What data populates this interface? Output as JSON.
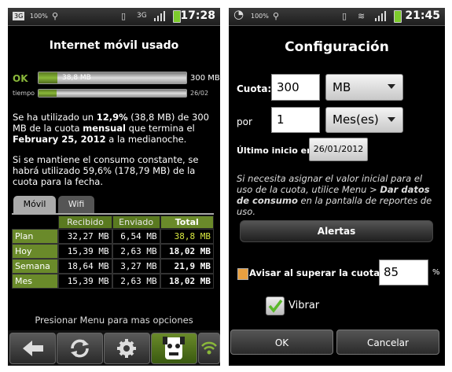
{
  "left": {
    "status_bar": {
      "time": "17:28",
      "network": "3G",
      "left_icons": [
        "3G",
        "100%"
      ]
    },
    "title": "Internet móvil usado",
    "usage_bar": {
      "status": "OK",
      "used_label": "38,8 MB",
      "total_label": "300 MB",
      "used_fraction": 0.129
    },
    "time_bar": {
      "label": "tiempo",
      "end_label": "26/02",
      "elapsed_fraction": 0.12
    },
    "summary": {
      "p1": "Se ha utilizado un ",
      "pct": "12,9%",
      "p2": " (38,8 MB) de 300 MB de la cuota ",
      "period": "mensual",
      "p3": " que termina el ",
      "date": "February 25, 2012",
      "p4": " a la medianoche."
    },
    "projection": "Si se mantiene el consumo constante, se habrá utilizado 59,6% (178,79 MB) de la cuota para la fecha.",
    "tabs": [
      "Móvil",
      "Wifi"
    ],
    "table": {
      "headers": [
        "Recibido",
        "Enviado",
        "Total"
      ],
      "rows": [
        {
          "label": "Plan",
          "recibido": "32,27 MB",
          "enviado": "6,54 MB",
          "total": "38,8 MB"
        },
        {
          "label": "Hoy",
          "recibido": "15,39 MB",
          "enviado": "2,63 MB",
          "total": "18,02 MB"
        },
        {
          "label": "Semana",
          "recibido": "18,64 MB",
          "enviado": "3,27 MB",
          "total": "21,9 MB"
        },
        {
          "label": "Mes",
          "recibido": "15,39 MB",
          "enviado": "2,63 MB",
          "total": "18,02 MB"
        }
      ]
    },
    "hint": "Presionar Menu para mas opciones",
    "bottom_buttons": [
      "back-arrow-icon",
      "refresh-icon",
      "settings-gear-icon",
      "app-mascot-icon",
      "wifi-icon"
    ],
    "colors": {
      "accent_green": "#8ab83a",
      "highlight_yellow": "#d8e840"
    }
  },
  "right": {
    "status_bar": {
      "time": "21:45",
      "left_icons": [
        "app-icon",
        "100%"
      ]
    },
    "title": "Configuración",
    "cuota_label": "Cuota:",
    "cuota_value": "300",
    "cuota_unit": "MB",
    "por_label": "por",
    "por_value": "1",
    "por_unit": "Mes(es)",
    "last_start_label": "Último inicio en",
    "last_start_value": "26/01/2012",
    "info": {
      "p1": "Si necesita asignar el valor inicial para el uso de la cuota, utilice Menu > ",
      "bold": "Dar datos de consumo",
      "p2": " en la pantalla de reportes de uso."
    },
    "alerts_button": "Alertas",
    "alert_threshold_label": "Avisar al superar la cuota en",
    "alert_threshold_value": "85",
    "alert_unit": "%",
    "vibrate_label": "Vibrar",
    "vibrate_checked": true,
    "ok_button": "OK",
    "cancel_button": "Cancelar"
  }
}
